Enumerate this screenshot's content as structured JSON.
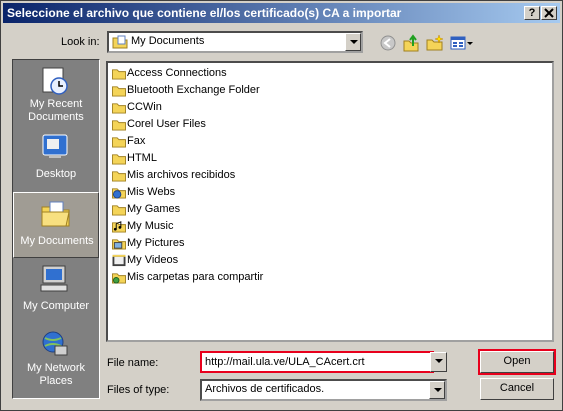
{
  "window": {
    "title": "Seleccione el archivo que contiene el/los certificado(s) CA a importar",
    "help_label": "?",
    "close_label": "X"
  },
  "lookin": {
    "label": "Look in:",
    "value": "My Documents"
  },
  "places": [
    {
      "label": "My Recent Documents",
      "icon": "recent-documents-icon"
    },
    {
      "label": "Desktop",
      "icon": "desktop-icon"
    },
    {
      "label": "My Documents",
      "icon": "my-documents-icon",
      "selected": true
    },
    {
      "label": "My Computer",
      "icon": "my-computer-icon"
    },
    {
      "label": "My Network Places",
      "icon": "network-places-icon"
    }
  ],
  "files": [
    {
      "name": "Access Connections",
      "icon": "folder-icon"
    },
    {
      "name": "Bluetooth Exchange Folder",
      "icon": "folder-icon"
    },
    {
      "name": "CCWin",
      "icon": "folder-icon"
    },
    {
      "name": "Corel User Files",
      "icon": "folder-icon"
    },
    {
      "name": "Fax",
      "icon": "folder-icon"
    },
    {
      "name": "HTML",
      "icon": "folder-icon"
    },
    {
      "name": "Mis archivos recibidos",
      "icon": "folder-icon"
    },
    {
      "name": "Mis Webs",
      "icon": "web-folder-icon"
    },
    {
      "name": "My Games",
      "icon": "folder-icon"
    },
    {
      "name": "My Music",
      "icon": "music-folder-icon"
    },
    {
      "name": "My Pictures",
      "icon": "pictures-folder-icon"
    },
    {
      "name": "My Videos",
      "icon": "videos-folder-icon"
    },
    {
      "name": "Mis carpetas para compartir",
      "icon": "shared-folder-icon"
    }
  ],
  "filename": {
    "label": "File name:",
    "value": "http://mail.ula.ve/ULA_CAcert.crt"
  },
  "filetype": {
    "label": "Files of type:",
    "value": "Archivos de certificados."
  },
  "buttons": {
    "open": "Open",
    "cancel": "Cancel"
  },
  "colors": {
    "title_start": "#0a246a",
    "title_end": "#a6caf0",
    "highlight": "#e8001c",
    "folder": "#f4d458"
  }
}
